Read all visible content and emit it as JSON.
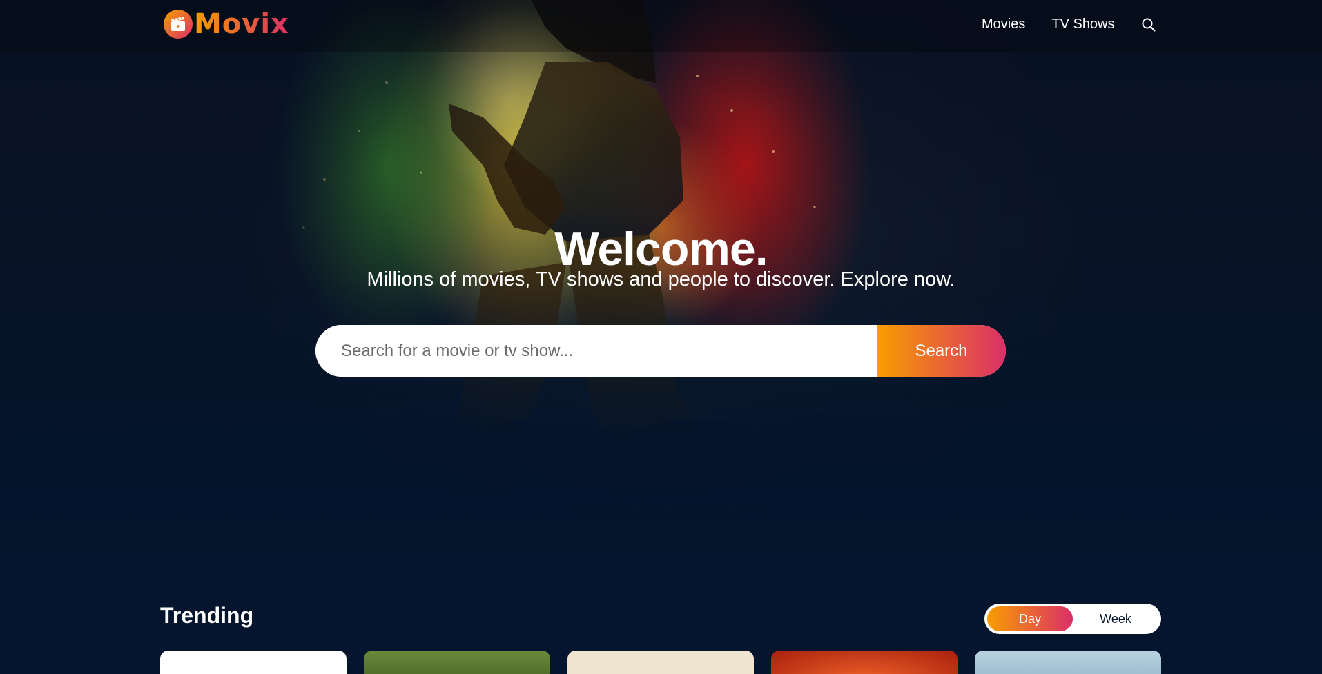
{
  "header": {
    "logo_text": "Movix",
    "nav": {
      "movies": "Movies",
      "tv_shows": "TV Shows",
      "search_icon": "search-icon"
    }
  },
  "hero": {
    "title": "Welcome.",
    "subtitle": "Millions of movies, TV shows and people to discover. Explore now.",
    "search": {
      "placeholder": "Search for a movie or tv show...",
      "value": "",
      "button_label": "Search"
    }
  },
  "trending": {
    "title": "Trending",
    "tabs": [
      "Day",
      "Week"
    ],
    "active_tab": "Day"
  },
  "colors": {
    "background": "#04152d",
    "accent_start": "#f89e00",
    "accent_end": "#da2f68"
  }
}
